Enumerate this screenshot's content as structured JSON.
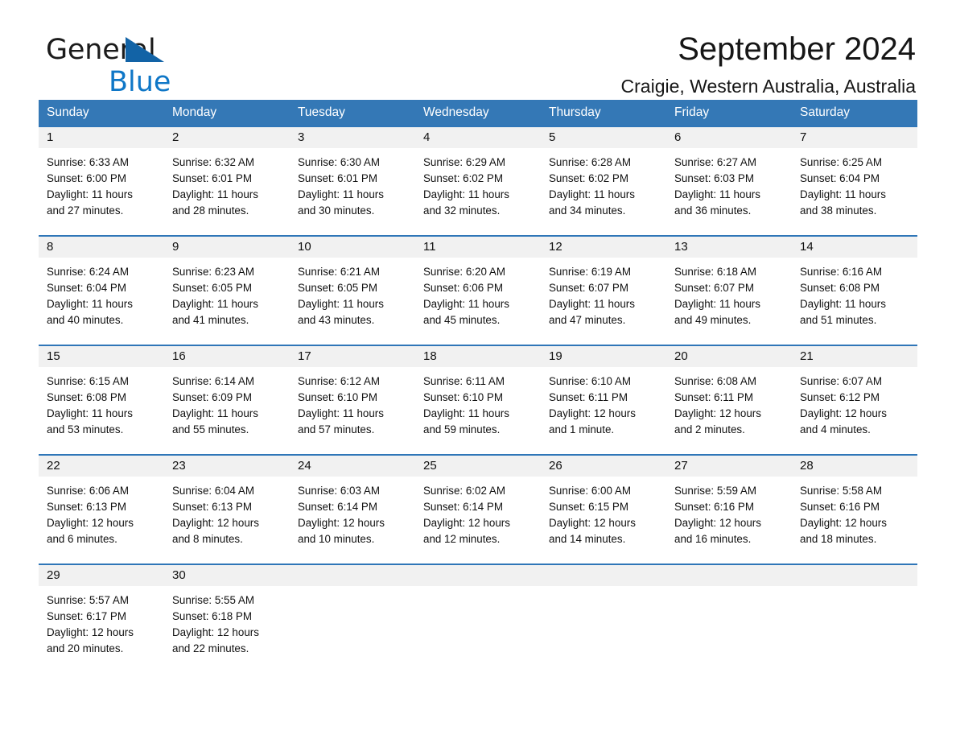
{
  "brand": {
    "name_part1": "General",
    "name_part2": "Blue",
    "accent_color": "#0f77c7",
    "triangle_color": "#1263a6"
  },
  "header": {
    "title": "September 2024",
    "subtitle": "Craigie, Western Australia, Australia"
  },
  "theme": {
    "header_row_bg": "#3478b6",
    "week_divider": "#2f76b8",
    "daynum_band_bg": "#f1f1f1",
    "page_bg": "#ffffff",
    "text_color": "#111111"
  },
  "weekdays": [
    "Sunday",
    "Monday",
    "Tuesday",
    "Wednesday",
    "Thursday",
    "Friday",
    "Saturday"
  ],
  "weeks": [
    [
      {
        "day": "1",
        "sunrise": "Sunrise: 6:33 AM",
        "sunset": "Sunset: 6:00 PM",
        "daylight_line1": "Daylight: 11 hours",
        "daylight_line2": "and 27 minutes."
      },
      {
        "day": "2",
        "sunrise": "Sunrise: 6:32 AM",
        "sunset": "Sunset: 6:01 PM",
        "daylight_line1": "Daylight: 11 hours",
        "daylight_line2": "and 28 minutes."
      },
      {
        "day": "3",
        "sunrise": "Sunrise: 6:30 AM",
        "sunset": "Sunset: 6:01 PM",
        "daylight_line1": "Daylight: 11 hours",
        "daylight_line2": "and 30 minutes."
      },
      {
        "day": "4",
        "sunrise": "Sunrise: 6:29 AM",
        "sunset": "Sunset: 6:02 PM",
        "daylight_line1": "Daylight: 11 hours",
        "daylight_line2": "and 32 minutes."
      },
      {
        "day": "5",
        "sunrise": "Sunrise: 6:28 AM",
        "sunset": "Sunset: 6:02 PM",
        "daylight_line1": "Daylight: 11 hours",
        "daylight_line2": "and 34 minutes."
      },
      {
        "day": "6",
        "sunrise": "Sunrise: 6:27 AM",
        "sunset": "Sunset: 6:03 PM",
        "daylight_line1": "Daylight: 11 hours",
        "daylight_line2": "and 36 minutes."
      },
      {
        "day": "7",
        "sunrise": "Sunrise: 6:25 AM",
        "sunset": "Sunset: 6:04 PM",
        "daylight_line1": "Daylight: 11 hours",
        "daylight_line2": "and 38 minutes."
      }
    ],
    [
      {
        "day": "8",
        "sunrise": "Sunrise: 6:24 AM",
        "sunset": "Sunset: 6:04 PM",
        "daylight_line1": "Daylight: 11 hours",
        "daylight_line2": "and 40 minutes."
      },
      {
        "day": "9",
        "sunrise": "Sunrise: 6:23 AM",
        "sunset": "Sunset: 6:05 PM",
        "daylight_line1": "Daylight: 11 hours",
        "daylight_line2": "and 41 minutes."
      },
      {
        "day": "10",
        "sunrise": "Sunrise: 6:21 AM",
        "sunset": "Sunset: 6:05 PM",
        "daylight_line1": "Daylight: 11 hours",
        "daylight_line2": "and 43 minutes."
      },
      {
        "day": "11",
        "sunrise": "Sunrise: 6:20 AM",
        "sunset": "Sunset: 6:06 PM",
        "daylight_line1": "Daylight: 11 hours",
        "daylight_line2": "and 45 minutes."
      },
      {
        "day": "12",
        "sunrise": "Sunrise: 6:19 AM",
        "sunset": "Sunset: 6:07 PM",
        "daylight_line1": "Daylight: 11 hours",
        "daylight_line2": "and 47 minutes."
      },
      {
        "day": "13",
        "sunrise": "Sunrise: 6:18 AM",
        "sunset": "Sunset: 6:07 PM",
        "daylight_line1": "Daylight: 11 hours",
        "daylight_line2": "and 49 minutes."
      },
      {
        "day": "14",
        "sunrise": "Sunrise: 6:16 AM",
        "sunset": "Sunset: 6:08 PM",
        "daylight_line1": "Daylight: 11 hours",
        "daylight_line2": "and 51 minutes."
      }
    ],
    [
      {
        "day": "15",
        "sunrise": "Sunrise: 6:15 AM",
        "sunset": "Sunset: 6:08 PM",
        "daylight_line1": "Daylight: 11 hours",
        "daylight_line2": "and 53 minutes."
      },
      {
        "day": "16",
        "sunrise": "Sunrise: 6:14 AM",
        "sunset": "Sunset: 6:09 PM",
        "daylight_line1": "Daylight: 11 hours",
        "daylight_line2": "and 55 minutes."
      },
      {
        "day": "17",
        "sunrise": "Sunrise: 6:12 AM",
        "sunset": "Sunset: 6:10 PM",
        "daylight_line1": "Daylight: 11 hours",
        "daylight_line2": "and 57 minutes."
      },
      {
        "day": "18",
        "sunrise": "Sunrise: 6:11 AM",
        "sunset": "Sunset: 6:10 PM",
        "daylight_line1": "Daylight: 11 hours",
        "daylight_line2": "and 59 minutes."
      },
      {
        "day": "19",
        "sunrise": "Sunrise: 6:10 AM",
        "sunset": "Sunset: 6:11 PM",
        "daylight_line1": "Daylight: 12 hours",
        "daylight_line2": "and 1 minute."
      },
      {
        "day": "20",
        "sunrise": "Sunrise: 6:08 AM",
        "sunset": "Sunset: 6:11 PM",
        "daylight_line1": "Daylight: 12 hours",
        "daylight_line2": "and 2 minutes."
      },
      {
        "day": "21",
        "sunrise": "Sunrise: 6:07 AM",
        "sunset": "Sunset: 6:12 PM",
        "daylight_line1": "Daylight: 12 hours",
        "daylight_line2": "and 4 minutes."
      }
    ],
    [
      {
        "day": "22",
        "sunrise": "Sunrise: 6:06 AM",
        "sunset": "Sunset: 6:13 PM",
        "daylight_line1": "Daylight: 12 hours",
        "daylight_line2": "and 6 minutes."
      },
      {
        "day": "23",
        "sunrise": "Sunrise: 6:04 AM",
        "sunset": "Sunset: 6:13 PM",
        "daylight_line1": "Daylight: 12 hours",
        "daylight_line2": "and 8 minutes."
      },
      {
        "day": "24",
        "sunrise": "Sunrise: 6:03 AM",
        "sunset": "Sunset: 6:14 PM",
        "daylight_line1": "Daylight: 12 hours",
        "daylight_line2": "and 10 minutes."
      },
      {
        "day": "25",
        "sunrise": "Sunrise: 6:02 AM",
        "sunset": "Sunset: 6:14 PM",
        "daylight_line1": "Daylight: 12 hours",
        "daylight_line2": "and 12 minutes."
      },
      {
        "day": "26",
        "sunrise": "Sunrise: 6:00 AM",
        "sunset": "Sunset: 6:15 PM",
        "daylight_line1": "Daylight: 12 hours",
        "daylight_line2": "and 14 minutes."
      },
      {
        "day": "27",
        "sunrise": "Sunrise: 5:59 AM",
        "sunset": "Sunset: 6:16 PM",
        "daylight_line1": "Daylight: 12 hours",
        "daylight_line2": "and 16 minutes."
      },
      {
        "day": "28",
        "sunrise": "Sunrise: 5:58 AM",
        "sunset": "Sunset: 6:16 PM",
        "daylight_line1": "Daylight: 12 hours",
        "daylight_line2": "and 18 minutes."
      }
    ],
    [
      {
        "day": "29",
        "sunrise": "Sunrise: 5:57 AM",
        "sunset": "Sunset: 6:17 PM",
        "daylight_line1": "Daylight: 12 hours",
        "daylight_line2": "and 20 minutes."
      },
      {
        "day": "30",
        "sunrise": "Sunrise: 5:55 AM",
        "sunset": "Sunset: 6:18 PM",
        "daylight_line1": "Daylight: 12 hours",
        "daylight_line2": "and 22 minutes."
      },
      {
        "day": "",
        "sunrise": "",
        "sunset": "",
        "daylight_line1": "",
        "daylight_line2": ""
      },
      {
        "day": "",
        "sunrise": "",
        "sunset": "",
        "daylight_line1": "",
        "daylight_line2": ""
      },
      {
        "day": "",
        "sunrise": "",
        "sunset": "",
        "daylight_line1": "",
        "daylight_line2": ""
      },
      {
        "day": "",
        "sunrise": "",
        "sunset": "",
        "daylight_line1": "",
        "daylight_line2": ""
      },
      {
        "day": "",
        "sunrise": "",
        "sunset": "",
        "daylight_line1": "",
        "daylight_line2": ""
      }
    ]
  ]
}
